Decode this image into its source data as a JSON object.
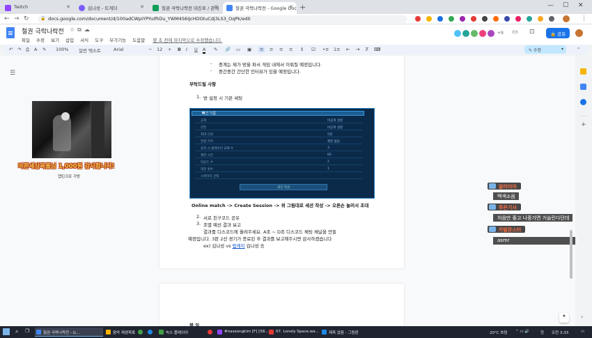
{
  "browser": {
    "tabs": [
      {
        "label": "Twitch",
        "color": "#9146ff"
      },
      {
        "label": "김나성 - 트게더",
        "color": "#7b5cff"
      },
      {
        "label": "철권 극락나락전 대진표 / 관세",
        "color": "#0f9d58"
      },
      {
        "label": "철권 극락나락전 - Google Docs",
        "color": "#4285f4"
      }
    ],
    "url": "docs.google.com/document/d/100adCWpIYPYuIfhDu_YWM4S6IJcHDOtuCdj3LS3_OqPk/edit"
  },
  "docs": {
    "title": "철권 극락나락전",
    "menus": [
      "파일",
      "수정",
      "보기",
      "삽입",
      "서식",
      "도구",
      "부가기능",
      "도움말"
    ],
    "last_edit": "몇 초 전에 마지막으로 수정했습니다.",
    "share_label": "공유",
    "collaborator_count": "+9",
    "toolbar": {
      "zoom": "100%",
      "style": "일반 텍스트",
      "font": "Arial",
      "size": "12",
      "mode": "수정"
    }
  },
  "content": {
    "bullet1": "중계는 제가 방을 파서 게임 내에서 이뤄질 예정입니다.",
    "bullet2": "중간중간 간단한 인터뷰가 있을 예정입니다.",
    "heading": "부탁드릴 사항",
    "item1_num": "1.",
    "item1": "방 설정 시 기본 세팅",
    "caption": "Online match -> Create Session -> 위 그림대로 세션 작성 -> 오른손 눌러서 초대",
    "item2_num": "2.",
    "item2": "서로 친구코드 공유",
    "item3_num": "3.",
    "item3": "조별 예선 결과 보고",
    "para1": "결과를 디스코드에 올려주세요. A조 ~ D조 디스코드 채팅 채널을 만들",
    "para2": "예정입니다. 3판 2선 경기가 종료된 후 결과를 보고해주시면 감사하겠습니다",
    "para3_a": "ex) 김나성 vs ",
    "para3_link": "럽케이",
    "para3_b": " 김나성 승",
    "page2_heading": "할 일"
  },
  "game_settings": {
    "header": "세션 이름",
    "rows": [
      {
        "key": "공개",
        "value": "비공개 설정"
      },
      {
        "key": "관전",
        "value": "비공개 설정"
      },
      {
        "key": "최대 인원",
        "value": "5명"
      },
      {
        "key": "연결 지역",
        "value": "제한 없음"
      },
      {
        "key": "승리 시 플레이어 교체 수",
        "value": "3"
      },
      {
        "key": "제한 시간",
        "value": "60"
      },
      {
        "key": "라운드 수",
        "value": "2"
      },
      {
        "key": "대전 횟수",
        "value": "1"
      },
      {
        "key": "스테이지 선택",
        "value": ""
      }
    ],
    "button": "세션 작성"
  },
  "stream": {
    "donation_text": "바른세상육플님 1,000원 감사합니다!",
    "donation_sub": "캡틴크로 가방"
  },
  "chat": [
    {
      "name": "알라이아",
      "message": "백색소음"
    },
    {
      "name": "투돈기사",
      "message": "처음만 좋고 나중가면 거슬린다던데"
    },
    {
      "name": "카발몬스터",
      "message": "asmr"
    }
  ],
  "taskbar": {
    "items": [
      {
        "label": "철권 극락나락전 - G...",
        "color": "#4285f4"
      },
      {
        "label": "음악 재생목록",
        "color": "#ffb300"
      },
      {
        "label": "녹스 플레이어",
        "color": "#43a047"
      },
      {
        "label": "#naseongkim [F] [58...",
        "color": "#9146ff"
      },
      {
        "label": "07. Lonely Space.wa...",
        "color": "#e53935"
      },
      {
        "label": "제목 없음 - 그림판",
        "color": "#1e88e5"
      }
    ],
    "weather": "20°C 흐림",
    "ime": "한",
    "time": "오전 3:33"
  }
}
